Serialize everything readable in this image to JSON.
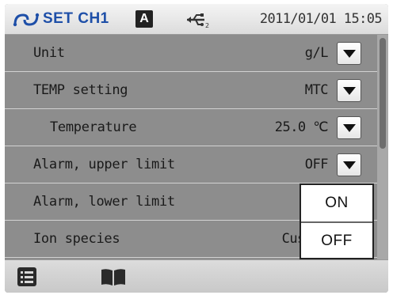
{
  "status": {
    "channel_icon": "channel-link-icon",
    "title": "SET CH1",
    "mode_badge": "A",
    "usb_icon": "usb-icon",
    "datetime": "2011/01/01 15:05"
  },
  "settings": [
    {
      "label": "Unit",
      "value": "g/L"
    },
    {
      "label": "TEMP setting",
      "value": "MTC"
    },
    {
      "label": "Temperature",
      "value": "25.0 ℃"
    },
    {
      "label": "Alarm, upper limit",
      "value": "OFF"
    },
    {
      "label": "Alarm, lower limit",
      "value": ""
    },
    {
      "label": "Ion species",
      "value": "Custom"
    }
  ],
  "popup": {
    "options": [
      "ON",
      "OFF"
    ]
  },
  "bottom": {
    "menu_icon": "menu-list-icon",
    "book_icon": "book-icon"
  },
  "colors": {
    "title_blue": "#1e4fa8",
    "list_bg": "#8d8d8d"
  }
}
